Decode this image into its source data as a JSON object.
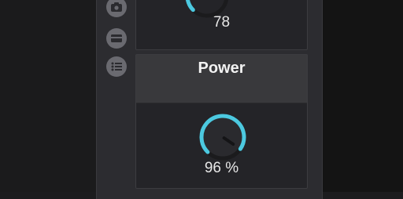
{
  "colors": {
    "accent": "#4cc9e0",
    "panel": "#2c2c30",
    "card": "#242428",
    "card_header": "#39393c",
    "text": "#e8e8e8"
  },
  "sidebar": {
    "buttons": [
      {
        "icon": "camera-icon"
      },
      {
        "icon": "card-icon"
      },
      {
        "icon": "list-icon"
      }
    ]
  },
  "top_card": {
    "value_text": "78",
    "level": 0.78
  },
  "power_card": {
    "title": "Power",
    "value_text": "96 %",
    "level": 0.96
  }
}
